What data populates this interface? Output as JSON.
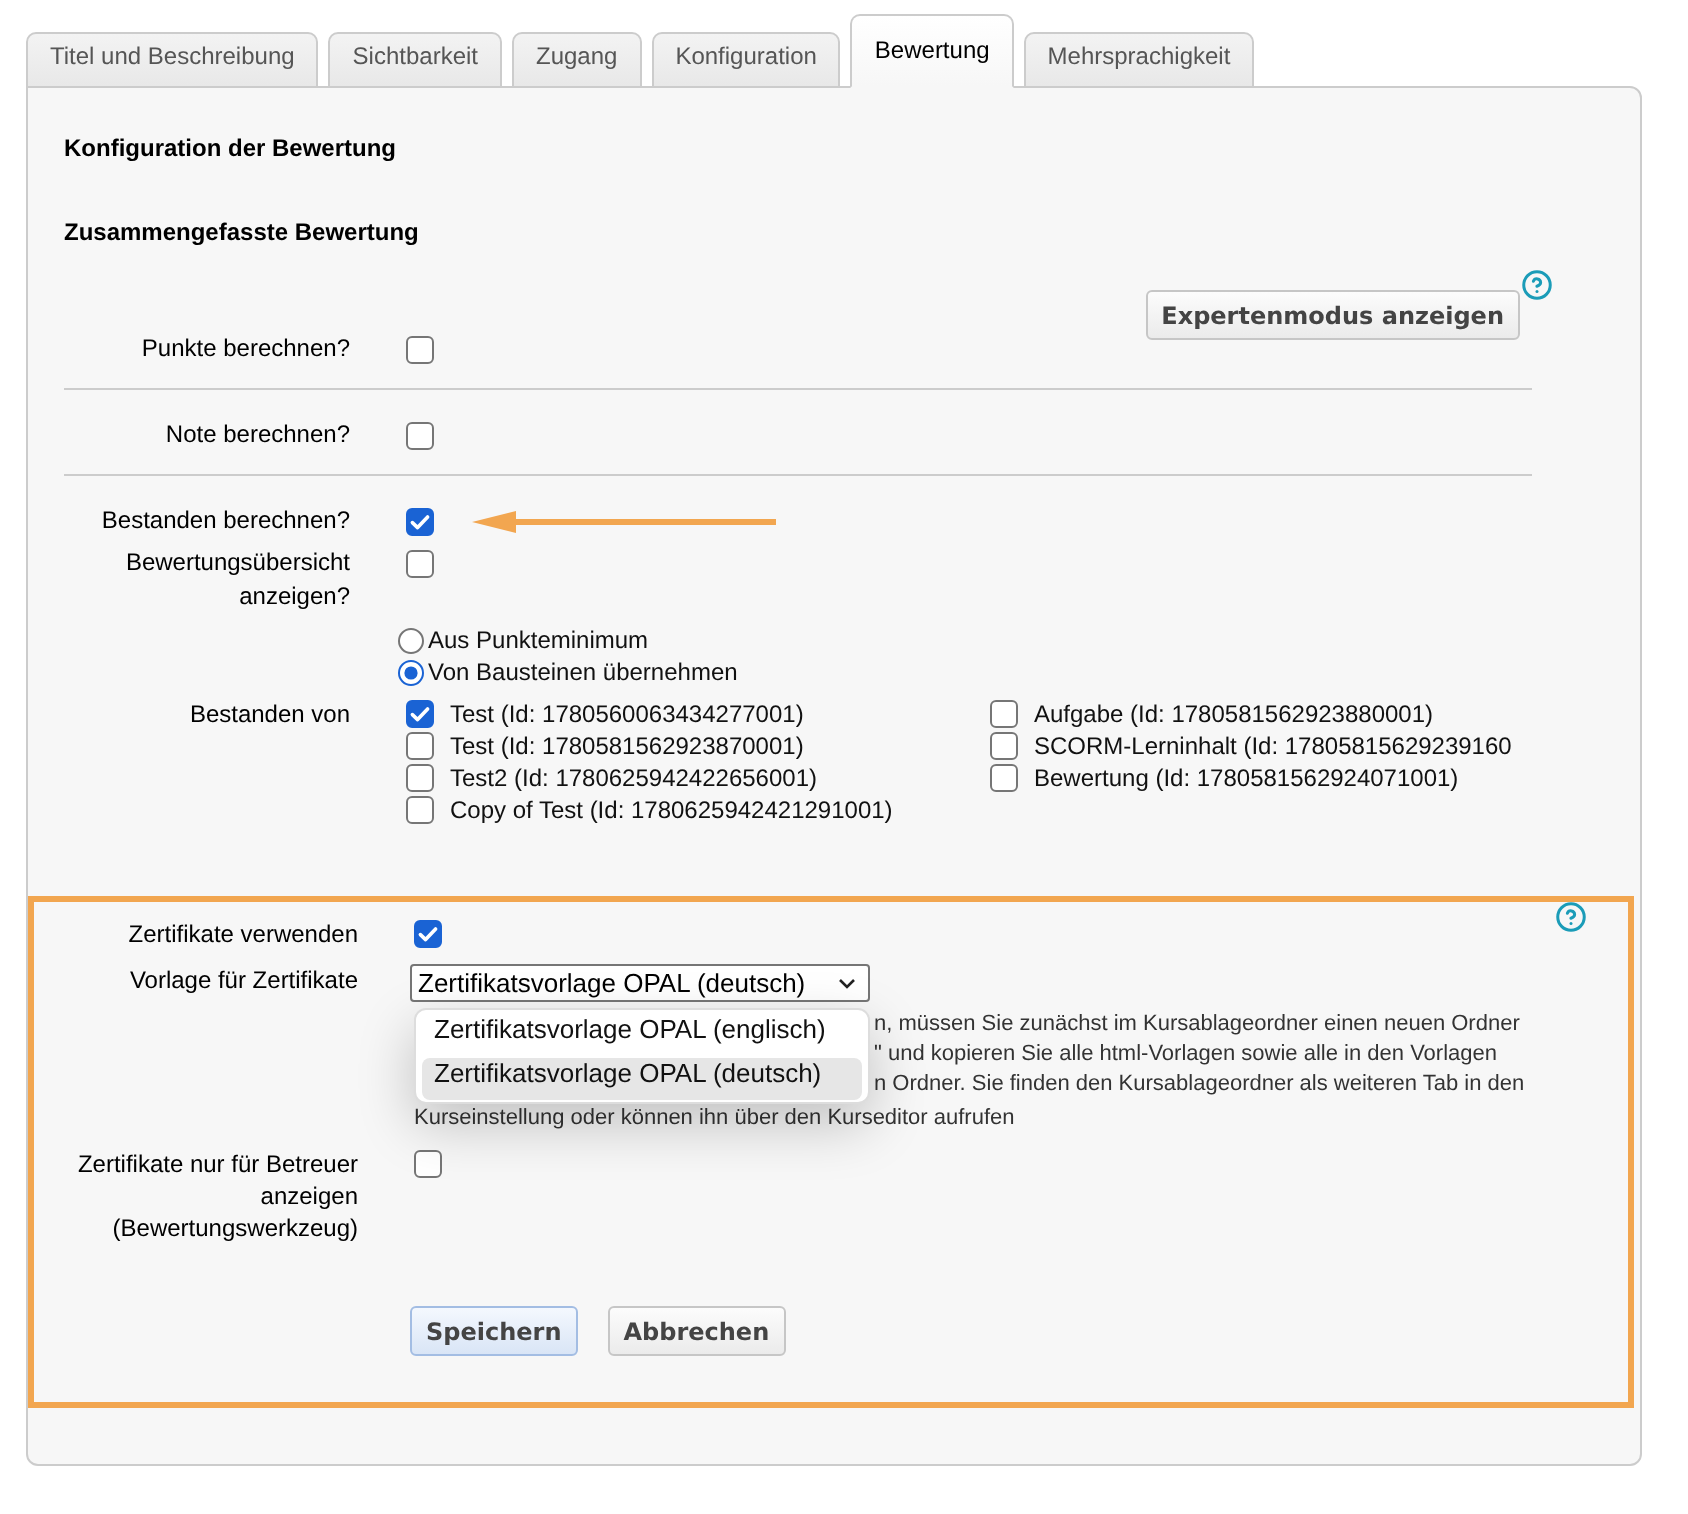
{
  "tabs": [
    {
      "label": "Titel und Beschreibung",
      "selected": false
    },
    {
      "label": "Sichtbarkeit",
      "selected": false
    },
    {
      "label": "Zugang",
      "selected": false
    },
    {
      "label": "Konfiguration",
      "selected": false
    },
    {
      "label": "Bewertung",
      "selected": true
    },
    {
      "label": "Mehrsprachigkeit",
      "selected": false
    }
  ],
  "assessment": {
    "title": "Konfiguration der Bewertung",
    "section_title": "Zusammengefasste Bewertung",
    "expert_button": "Expertenmodus anzeigen",
    "rows": [
      {
        "label": "Punkte berechnen?",
        "checked": false,
        "divider": true,
        "arrow": false
      },
      {
        "label": "Note berechnen?",
        "checked": false,
        "divider": true,
        "arrow": false
      },
      {
        "label": "Bestanden berechnen?",
        "checked": true,
        "divider": false,
        "arrow": true
      },
      {
        "label": "Bewertungsübersicht anzeigen?",
        "checked": false,
        "divider": false,
        "arrow": false
      }
    ],
    "pass_source": [
      {
        "label": "Aus Punkteminimum",
        "selected": false
      },
      {
        "label": "Von Bausteinen übernehmen",
        "selected": true
      }
    ],
    "passed_from": {
      "label": "Bestanden von",
      "columns": [
        [
          {
            "label": "Test (Id: 1780560063434277001)",
            "checked": true
          },
          {
            "label": "Test (Id: 1780581562923870001)",
            "checked": false
          },
          {
            "label": "Test2 (Id: 1780625942422656001)",
            "checked": false
          },
          {
            "label": "Copy of Test (Id: 1780625942421291001)",
            "checked": false
          }
        ],
        [
          {
            "label": "Aufgabe (Id: 1780581562923880001)",
            "checked": false
          },
          {
            "label": "SCORM-Lerninhalt (Id: 17805815629239160",
            "checked": false
          },
          {
            "label": "Bewertung (Id: 1780581562924071001)",
            "checked": false
          }
        ]
      ]
    }
  },
  "certificates": {
    "use": {
      "label": "Zertifikate verwenden",
      "checked": true
    },
    "template": {
      "label": "Vorlage für Zertifikate",
      "value": "Zertifikatsvorlage OPAL (deutsch)",
      "expanded": true,
      "options": [
        {
          "label": "Zertifikatsvorlage OPAL (englisch)",
          "selected": false
        },
        {
          "label": "Zertifikatsvorlage OPAL (deutsch)",
          "selected": true
        }
      ]
    },
    "help_lines_beside_menu": [
      "n, müssen Sie zunächst im Kursablageordner einen neuen Ordner",
      "\" und kopieren Sie alle html-Vorlagen sowie alle in den Vorlagen",
      "n Ordner. Sie finden den Kursablageordner als weiteren Tab in den"
    ],
    "help_line_below_menu": "Kurseinstellung oder können ihn über den Kurseditor aufrufen",
    "tutor_only": {
      "label": "Zertifikate nur für Betreuer anzeigen (Bewertungswerkzeug)",
      "checked": false
    }
  },
  "buttons": [
    {
      "label": "Speichern",
      "kind": "primary"
    },
    {
      "label": "Abbrechen",
      "kind": "secondary"
    }
  ]
}
